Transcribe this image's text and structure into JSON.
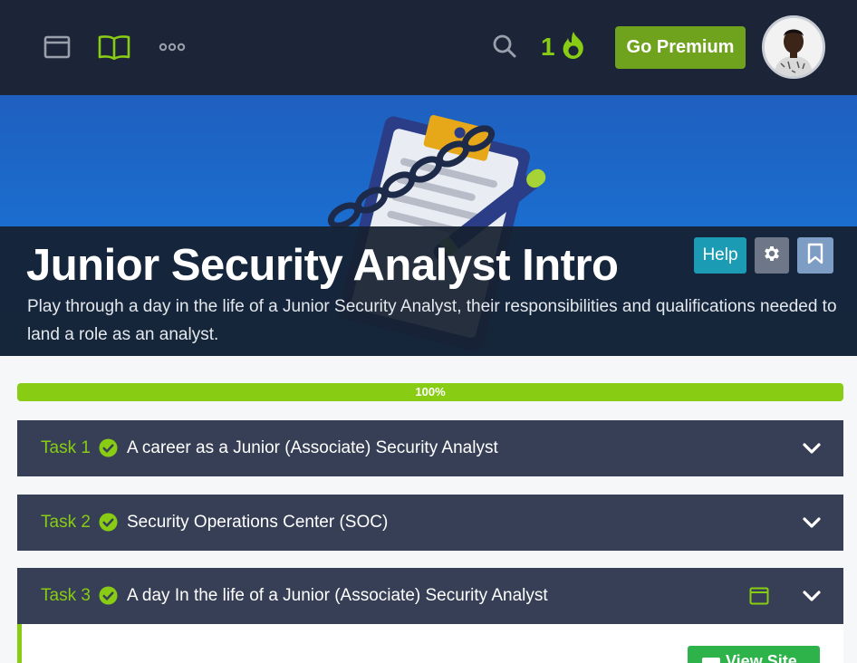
{
  "nav": {
    "streak_count": "1",
    "premium_label": "Go Premium",
    "icons": [
      "browser-icon",
      "book-icon",
      "more-icon",
      "search-icon",
      "flame-icon"
    ]
  },
  "room": {
    "title": "Junior Security Analyst Intro",
    "description": "Play through a day in the life of a Junior Security Analyst, their responsibilities and qualifications needed to land a role as an analyst.",
    "help_label": "Help"
  },
  "progress": {
    "value": 100,
    "label": "100%"
  },
  "tasks": [
    {
      "label": "Task 1",
      "title": "A career as a Junior (Associate) Security Analyst",
      "completed": true
    },
    {
      "label": "Task 2",
      "title": "Security Operations Center (SOC)",
      "completed": true
    },
    {
      "label": "Task 3",
      "title": "A day In the life of a Junior (Associate) Security Analyst",
      "completed": true
    }
  ],
  "task3_body": {
    "view_site_label": "View Site"
  },
  "colors": {
    "accent_green": "#88cc14",
    "nav_bg": "#1c2538",
    "task_bg": "#363f55",
    "help_bg": "#1c9bb5",
    "premium_bg": "#6fa31d"
  }
}
